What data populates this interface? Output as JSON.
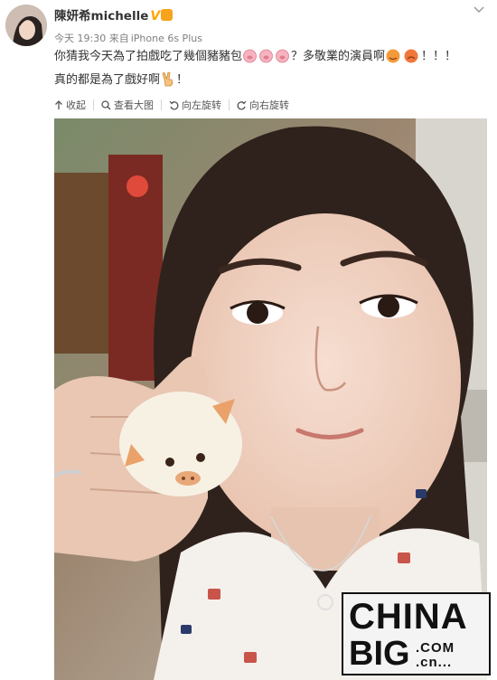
{
  "post": {
    "username": "陳妍希michelle",
    "verified_badge": "V",
    "timestamp": "今天 19:30",
    "source_prefix": "来自",
    "device": "iPhone 6s Plus",
    "text_part1": "你猜我今天為了拍戲吃了幾個豬豬包",
    "text_part2": "？多敬業的演員啊",
    "text_part3": "！！！",
    "text_line2": "真的都是為了戲好啊",
    "text_line2_end": "！"
  },
  "toolbar": {
    "collapse": "收起",
    "view_large": "查看大图",
    "rotate_left": "向左旋转",
    "rotate_right": "向右旋转"
  },
  "watermark": {
    "line1": "CHINA",
    "line2": "BIG",
    "line3a": ".COM",
    "line3b": ".cn..."
  },
  "icons": {
    "collapse": "arrow-up-icon",
    "view_large": "magnifier-icon",
    "rotate_left": "rotate-left-icon",
    "rotate_right": "rotate-right-icon",
    "more": "chevron-down-icon"
  },
  "colors": {
    "verified": "#ffa500",
    "meta_text": "#808080",
    "body_text": "#333333"
  }
}
